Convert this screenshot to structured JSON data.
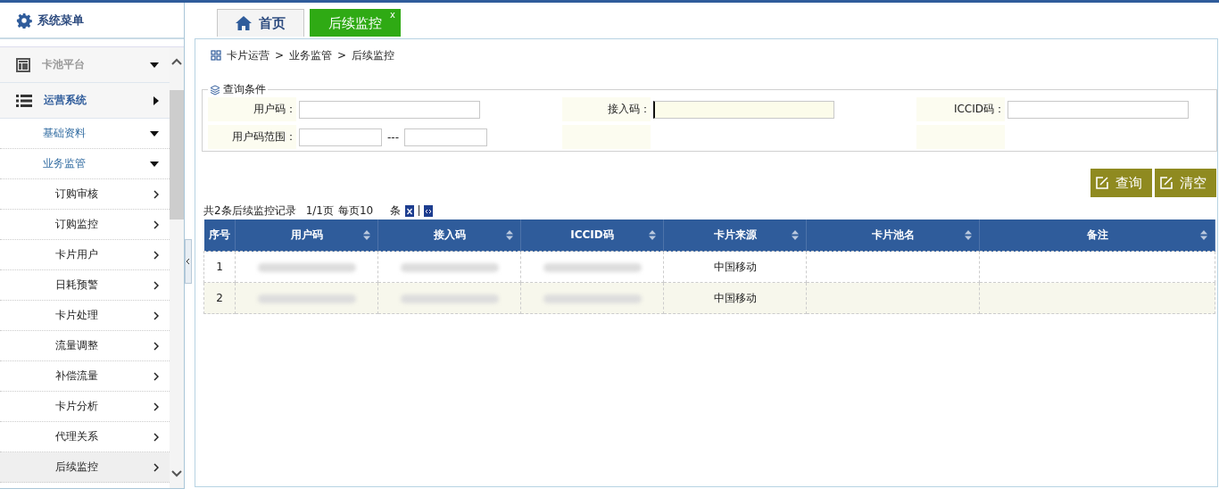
{
  "sidebar": {
    "title": "系统菜单",
    "items": [
      {
        "label": "卡池平台",
        "kind": "platform",
        "disabled": true,
        "expanded": true
      },
      {
        "label": "运营系统",
        "kind": "system",
        "disabled": false,
        "expanded": false,
        "children": [
          {
            "label": "基础资料",
            "expanded": true
          },
          {
            "label": "业务监管",
            "expanded": true,
            "children": [
              {
                "label": "订购审核",
                "selected": false
              },
              {
                "label": "订购监控",
                "selected": false
              },
              {
                "label": "卡片用户",
                "selected": false
              },
              {
                "label": "日耗预警",
                "selected": false
              },
              {
                "label": "卡片处理",
                "selected": false
              },
              {
                "label": "流量调整",
                "selected": false
              },
              {
                "label": "补偿流量",
                "selected": false
              },
              {
                "label": "卡片分析",
                "selected": false
              },
              {
                "label": "代理关系",
                "selected": false
              },
              {
                "label": "后续监控",
                "selected": true
              }
            ]
          }
        ]
      }
    ]
  },
  "tabs": [
    {
      "label": "首页",
      "kind": "home",
      "selected": false
    },
    {
      "label": "后续监控",
      "kind": "page",
      "selected": true,
      "close": "x"
    }
  ],
  "breadcrumb": {
    "items": [
      "卡片运营",
      "业务监管",
      "后续监控"
    ],
    "separators": [
      ">",
      ">"
    ]
  },
  "query": {
    "legend": "查询条件",
    "fields": [
      {
        "label": "用户码：",
        "focused": false
      },
      {
        "label": "接入码：",
        "focused": true
      },
      {
        "label": "ICCID码：",
        "focused": false
      }
    ],
    "range": {
      "label": "用户码范围：",
      "separator": "---"
    },
    "buttons": [
      "查询",
      "清空"
    ]
  },
  "pager": {
    "summary": "共2条后续监控记录",
    "page": "1/1页",
    "per_page": "每页10",
    "unit": "条"
  },
  "table": {
    "columns": [
      {
        "label": "序号",
        "sortable": false
      },
      {
        "label": "用户码",
        "sortable": true
      },
      {
        "label": "接入码",
        "sortable": true
      },
      {
        "label": "ICCID码",
        "sortable": true
      },
      {
        "label": "卡片来源",
        "sortable": true
      },
      {
        "label": "卡片池名",
        "sortable": true
      },
      {
        "label": "备注",
        "sortable": true
      }
    ],
    "rows": [
      {
        "index": "1",
        "card_source": "中国移动"
      },
      {
        "index": "2",
        "card_source": "中国移动"
      }
    ]
  }
}
